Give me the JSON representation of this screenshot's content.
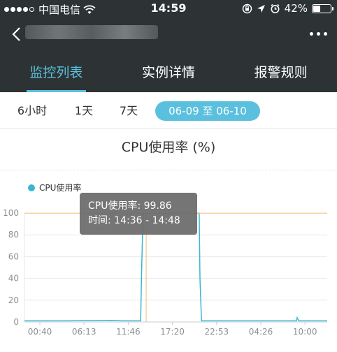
{
  "status": {
    "carrier": "中国电信",
    "time": "14:59",
    "battery_text": "42%",
    "battery_level": 0.42
  },
  "tabs": [
    {
      "label": "监控列表",
      "active": true
    },
    {
      "label": "实例详情",
      "active": false
    },
    {
      "label": "报警规则",
      "active": false
    }
  ],
  "filters": [
    "6小时",
    "1天",
    "7天",
    "06-09 至 06-10"
  ],
  "chart_title": "CPU使用率 (%)",
  "tooltip": {
    "line1": "CPU使用率: 99.86",
    "line2": "时间: 14:36 - 14:48"
  },
  "chart_data": {
    "type": "line",
    "legend_position": "top-left",
    "grid": true,
    "ylim": [
      0,
      100
    ],
    "yticks": [
      0,
      20,
      40,
      60,
      80,
      100
    ],
    "xticks": [
      "00:40",
      "06:13",
      "11:46",
      "17:20",
      "22:53",
      "04:26",
      "10:00"
    ],
    "x_range_hours": [
      0,
      38.3
    ],
    "series": [
      {
        "name": "CPU使用率",
        "color": "#38b6d3",
        "x_hours": [
          0,
          5.5,
          11,
          12.4,
          14.7,
          14.8,
          15.0,
          16.6,
          18.0,
          19.6,
          21.2,
          21.7,
          22.1,
          22.2,
          22.4,
          24,
          28,
          32,
          34.4,
          34.5,
          34.7,
          38.3
        ],
        "values": [
          1,
          1,
          1.5,
          1,
          1,
          40,
          99.86,
          99.86,
          99.86,
          99.86,
          99.86,
          99.86,
          99.86,
          40,
          1,
          1,
          1,
          1,
          1,
          4,
          1,
          1
        ]
      }
    ],
    "crosshair": {
      "x_hours": 15.4,
      "y": 99.86,
      "color": "#f5c27a"
    }
  }
}
